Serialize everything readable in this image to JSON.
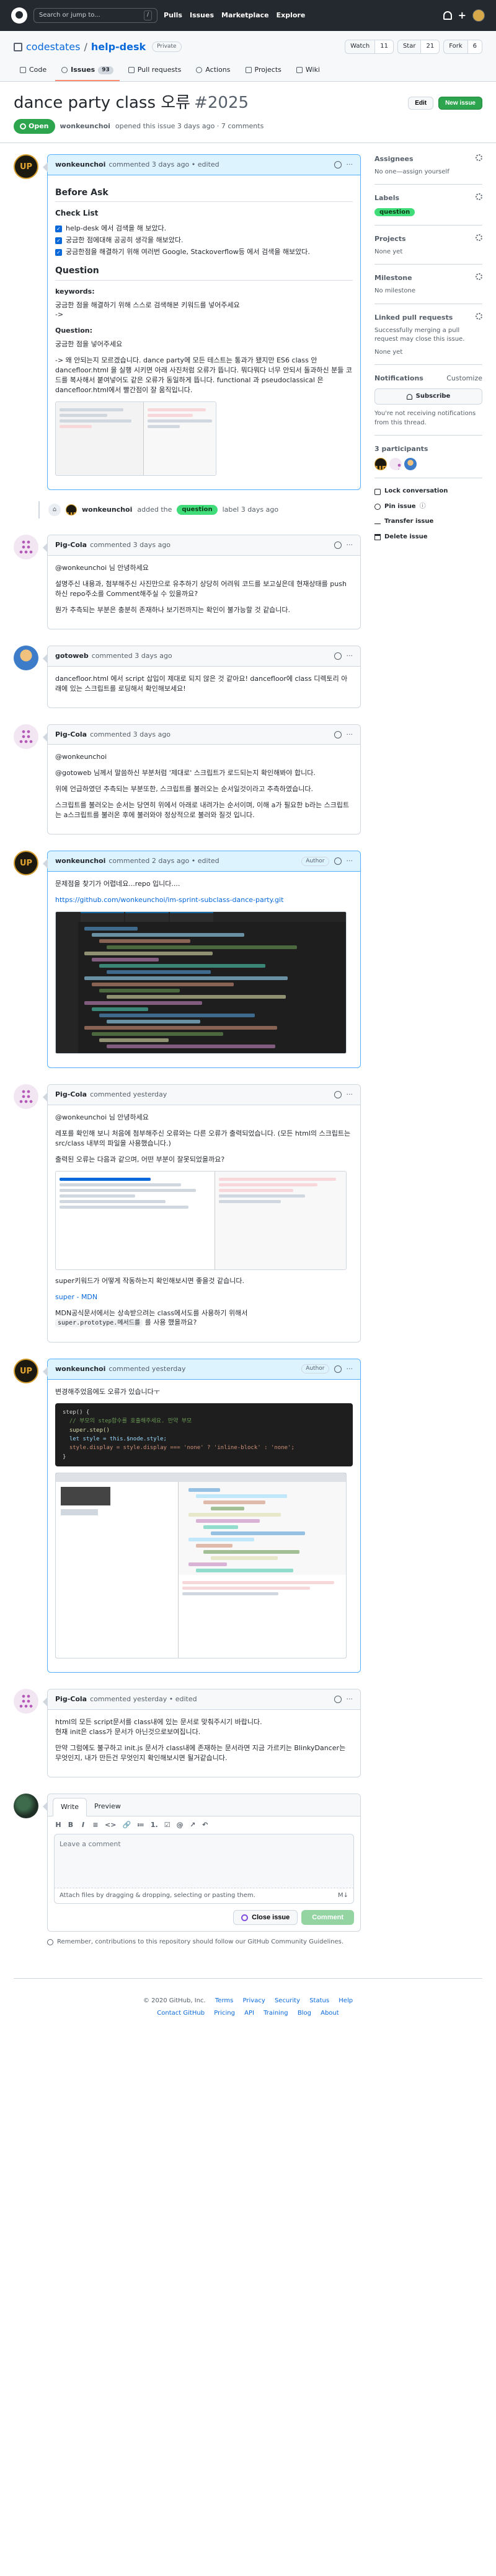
{
  "nav": {
    "search_placeholder": "Search or jump to...",
    "search_key": "/",
    "links": [
      "Pulls",
      "Issues",
      "Marketplace",
      "Explore"
    ]
  },
  "repo": {
    "owner": "codestates",
    "separator": "/",
    "name": "help-desk",
    "visibility": "Private",
    "watch": {
      "label": "Watch",
      "count": "11"
    },
    "star": {
      "label": "Star",
      "count": "21"
    },
    "fork": {
      "label": "Fork",
      "count": "6"
    },
    "tabs": [
      {
        "label": "Code"
      },
      {
        "label": "Issues",
        "count": "93"
      },
      {
        "label": "Pull requests"
      },
      {
        "label": "Actions"
      },
      {
        "label": "Projects"
      },
      {
        "label": "Wiki"
      }
    ]
  },
  "issue": {
    "title": "dance party class 오류",
    "number": "#2025",
    "edit_label": "Edit",
    "new_label": "New issue",
    "state": "Open",
    "opened_by": "wonkeunchoi",
    "opened_text": "opened this issue 3 days ago · 7 comments"
  },
  "comments": {
    "c1": {
      "author": "wonkeunchoi",
      "meta": "commented 3 days ago • edited",
      "h_before": "Before Ask",
      "h_check": "Check List",
      "tasks": [
        "help-desk 에서 검색을 해 보았다.",
        "궁금한 점에대해 공공히 생각을 해보았다.",
        "궁금한점을 해결하기 위해 여러번 Google, Stackoverflow등 에서 검색을 해보았다."
      ],
      "h_question": "Question",
      "h_keywords": "keywords:",
      "kw_text": "궁금한 점을 해결하기 위해 스스로 검색해본 키워드를 넣어주세요",
      "kw_arrow": "->",
      "h_q2": "Question:",
      "q_intro": "궁금한 점을 넣어주세요",
      "q_body": "-> 왜 안되는지 모르겠습니다. dance party에 모든 테스트는 통과가 됐지만 ES6 class 안 dancefloor.html 을 실행 시키면 아래 사진처럼 오류가 뜹니다. 뭐다뭐다 너무 안되서 돌과하신 분들 코드를 복사해서 붙여넣어도 같은 오류가 동일하게 뜹니다. functional 과 pseudoclassical 은 dancefloor.html에서 빨간점이 잘 움직입니다."
    },
    "event": {
      "actor": "wonkeunchoi",
      "pre": "added the",
      "label": "question",
      "post": "label 3 days ago"
    },
    "c2": {
      "author": "Pig-Cola",
      "meta": "commented 3 days ago",
      "p1": "@wonkeunchoi 님 안녕하세요",
      "p2": "설명주신 내용과, 첨부해주신 사진만으로 유추하기 상당히 어려워 코드를 보고싶은데 현재상태를 push하신 repo주소를 Comment해주실 수 있을까요?",
      "p3": "뭔가 추측되는 부분은 충분히 존재하나 보기전까지는 확인이 불가능할 것 같습니다."
    },
    "c3": {
      "author": "gotoweb",
      "meta": "commented 3 days ago",
      "p1": "dancefloor.html 에서 script 삽입이 제대로 되지 않은 것 같아요! dancefloor에 class 디렉토리 아래에 있는 스크립트를 로딩해서 확인해보세요!"
    },
    "c4": {
      "author": "Pig-Cola",
      "meta": "commented 3 days ago",
      "p1": "@wonkeunchoi",
      "p2": "@gotoweb 님께서 말씀하신 부분처럼 '제대로' 스크립트가 로드되는지 확인해봐야 합니다.",
      "p3": "위에 언급하였던 추측되는 부분또한, 스크립트를 불러오는 순서일것이라고 추측하였습니다.",
      "p4": "스크립트를 불러오는 순서는 당연히 위에서 아래로 내려가는 순서이며, 이해 a가 필요한 b라는 스크립트는 a스크립트를 불러온 후에 불러와야 정상적으로 불러와 질것 입니다."
    },
    "c5": {
      "author": "wonkeunchoi",
      "meta": "commented 2 days ago • edited",
      "role": "Author",
      "p1": "문제점을 찾기가 어렵네요...repo 입니다....",
      "link": "https://github.com/wonkeunchoi/im-sprint-subclass-dance-party.git"
    },
    "c6": {
      "author": "Pig-Cola",
      "meta": "commented yesterday",
      "p1": "@wonkeunchoi 님 안녕하세요",
      "p2": "레포를 확인해 보니 처음에 첨부해주신 오류와는 다른 오류가 출력되었습니다. (모든 html의 스크립트는 src/class 내부의 파일을 사용했습니다.)",
      "p3": "출력된 오류는 다음과 같으며, 어떤 부분이 잘못되었을까요?",
      "p4": "super키워드가 어떻게 작동하는지 확인해보시면 좋을것 같습니다.",
      "link": "super - MDN",
      "p5a": "MDN공식문서에서는 상속받으려는 class에서도를 사용하기 위해서",
      "code": "super.prototype.메서드를",
      "p5b": "를 사용 했을까요?"
    },
    "c7": {
      "author": "wonkeunchoi",
      "meta": "commented yesterday",
      "role": "Author",
      "p1": "변경해주었음에도 오류가 있습니다ㅜ",
      "code_lines": [
        "step() {",
        "  // 부모의 step함수를 호출해주세요. 만약 부모",
        "  super.step()",
        "  let style = this.$node.style;",
        "  style.display = style.display === 'none' ? 'inline-block' : 'none';",
        "}"
      ]
    },
    "c8": {
      "author": "Pig-Cola",
      "meta": "commented yesterday • edited",
      "p1": "html의 모든 script문서를 class내에 있는 문서로 맞춰주시기 바랍니다.",
      "p2": "현재 init은 class가 문서가 아닌것으로보여집니다.",
      "p3": "만약 그럼에도 불구하고 init.js 문서가 class내에 존재하는 문서라면 지금 가르키는 BlinkyDancer는 무엇인지, 내가 만든건 무엇인지 확인해보시면 될거같습니다."
    }
  },
  "editor": {
    "tab_write": "Write",
    "tab_preview": "Preview",
    "tools": [
      "H",
      "B",
      "I",
      "≡",
      "<>",
      "🔗",
      "≔",
      "1.",
      "☑",
      "@",
      "↗",
      "↶"
    ],
    "placeholder": "Leave a comment",
    "attach_text": "Attach files by dragging & dropping, selecting or pasting them.",
    "attach_icon": "M↓",
    "close_label": "Close issue",
    "comment_label": "Comment",
    "remember": "Remember, contributions to this repository should follow our GitHub Community Guidelines."
  },
  "sidebar": {
    "assignees": {
      "title": "Assignees",
      "text": "No one—assign yourself"
    },
    "labels": {
      "title": "Labels",
      "label": "question"
    },
    "projects": {
      "title": "Projects",
      "text": "None yet"
    },
    "milestone": {
      "title": "Milestone",
      "text": "No milestone"
    },
    "linked": {
      "title": "Linked pull requests",
      "text": "Successfully merging a pull request may close this issue.",
      "none": "None yet"
    },
    "notifications": {
      "title": "Notifications",
      "customize": "Customize",
      "subscribe": "Subscribe",
      "text": "You're not receiving notifications from this thread."
    },
    "participants": {
      "title": "3 participants"
    },
    "actions": [
      "Lock conversation",
      "Pin issue",
      "Transfer issue",
      "Delete issue"
    ],
    "pin_badge": "ⓘ"
  },
  "footer": {
    "copyright": "© 2020 GitHub, Inc.",
    "row1": [
      "Terms",
      "Privacy",
      "Security",
      "Status",
      "Help"
    ],
    "row2": [
      "Contact GitHub",
      "Pricing",
      "API",
      "Training",
      "Blog",
      "About"
    ]
  },
  "colors": {
    "accent": "#0969da",
    "open": "#2da44e",
    "label_question": "#3fdc79",
    "topbar": "#24292f"
  }
}
